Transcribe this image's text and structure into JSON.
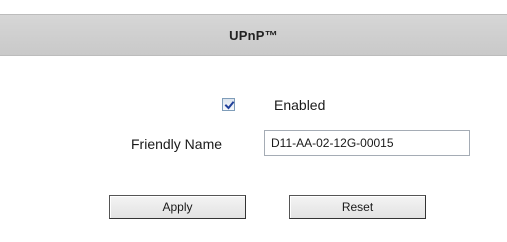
{
  "header": {
    "title": "UPnP™"
  },
  "upnp": {
    "enabled_label": "Enabled",
    "enabled_checked": true,
    "friendly_name_label": "Friendly Name",
    "friendly_name_value": "D11-AA-02-12G-00015"
  },
  "actions": {
    "apply_label": "Apply",
    "reset_label": "Reset"
  },
  "icons": {
    "checkmark": "checkmark-icon"
  },
  "colors": {
    "header_background": "#cfcfcf",
    "checkmark": "#21409a"
  }
}
